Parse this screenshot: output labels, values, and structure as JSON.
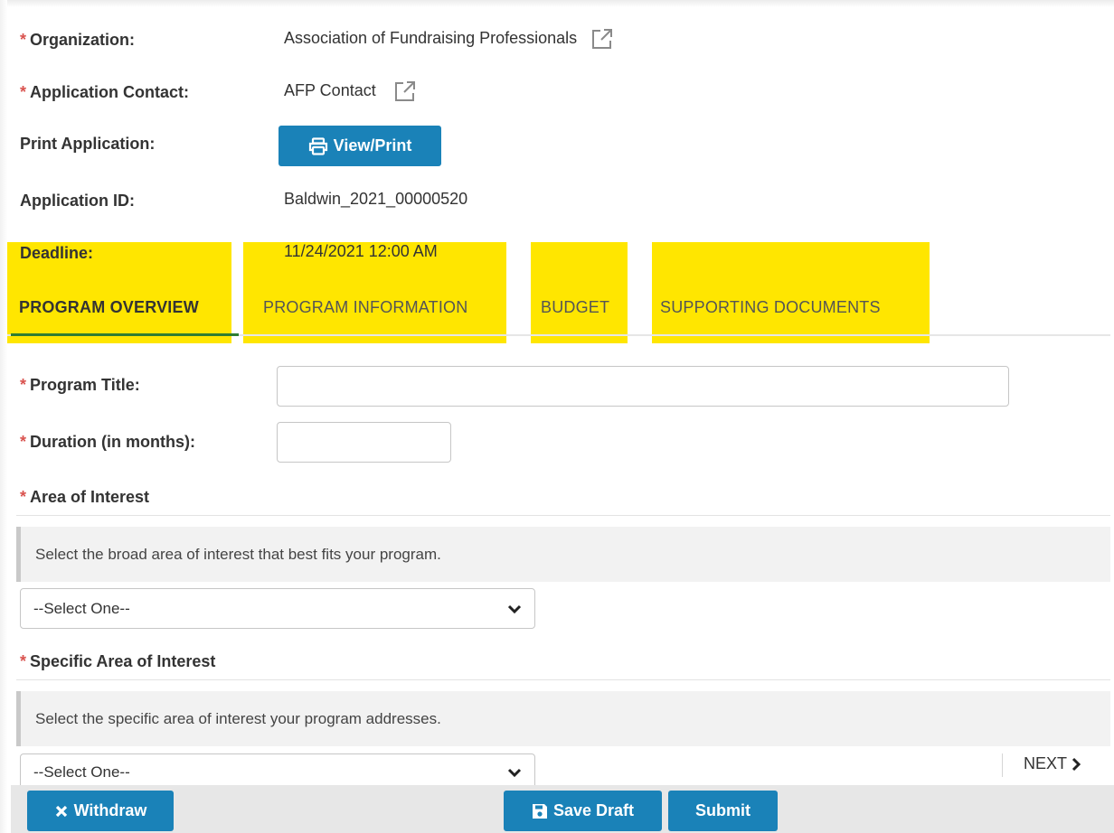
{
  "fields": {
    "organization": {
      "label": "Organization:",
      "value": "Association of Fundraising Professionals",
      "required": "*"
    },
    "contact": {
      "label": "Application Contact:",
      "value": "AFP Contact",
      "required": "*"
    },
    "print": {
      "label": "Print Application:",
      "button": "View/Print"
    },
    "app_id": {
      "label": "Application ID:",
      "value": "Baldwin_2021_00000520"
    },
    "deadline": {
      "label": "Deadline:",
      "value": "11/24/2021 12:00 AM"
    }
  },
  "tabs": [
    {
      "label": "PROGRAM OVERVIEW",
      "active": true
    },
    {
      "label": "PROGRAM INFORMATION",
      "active": false
    },
    {
      "label": "BUDGET",
      "active": false
    },
    {
      "label": "SUPPORTING DOCUMENTS",
      "active": false
    }
  ],
  "form": {
    "program_title": {
      "label": "Program Title:",
      "required": "*",
      "value": ""
    },
    "duration": {
      "label": "Duration (in months):",
      "required": "*",
      "value": ""
    },
    "area": {
      "label": "Area of Interest",
      "required": "*",
      "help": "Select the broad area of interest that best fits your program.",
      "selected": "--Select One--"
    },
    "specific_area": {
      "label": "Specific Area of Interest",
      "required": "*",
      "help": "Select the specific area of interest your program addresses.",
      "selected": "--Select One--"
    }
  },
  "nav": {
    "next": "NEXT"
  },
  "footer": {
    "withdraw": "Withdraw",
    "save_draft": "Save Draft",
    "submit": "Submit"
  },
  "colors": {
    "primary_button": "#1a82b8",
    "required": "#d9534f",
    "highlight": "#ffe600",
    "active_tab_underline": "#2e7d32"
  },
  "icons": [
    "external-link-icon",
    "printer-icon",
    "chevron-down-icon",
    "chevron-right-icon",
    "close-icon",
    "save-icon"
  ]
}
